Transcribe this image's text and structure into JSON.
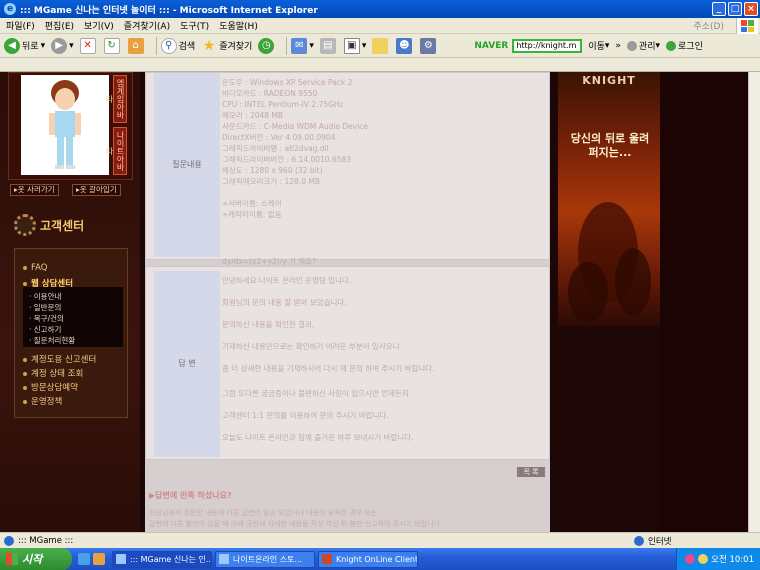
{
  "window": {
    "title": "::: MGame 신나는 인터넷 놀이터 ::: - Microsoft Internet Explorer",
    "buttons": [
      "_",
      "□",
      "×"
    ]
  },
  "menubar": {
    "items": [
      "파일(F)",
      "편집(E)",
      "보기(V)",
      "즐겨찾기(A)",
      "도구(T)",
      "도움말(H)"
    ],
    "right_label": "주소(D)"
  },
  "toolbar": {
    "back": "뒤로",
    "search": "검색",
    "favorites": "즐겨찾기",
    "naver": "NAVER",
    "url": "http://knight.m",
    "go": "이동",
    "manage": "관리",
    "login": "로그인"
  },
  "leftnav": {
    "vtab1": "엠게임아바타",
    "vtab2": "나이트아바타",
    "btn_buy": "옷 사러가기",
    "btn_change": "옷 갈아입기",
    "section_title": "고객센터",
    "menu": [
      "FAQ",
      "웹 상담센터",
      "계정도용 신고센터",
      "계정 상태 조회",
      "방문상담예약",
      "운영정책"
    ],
    "submenu": [
      "이용안내",
      "일반문의",
      "복구/건의",
      "신고하기",
      "질문처리현황"
    ]
  },
  "question": {
    "label": "질문내용",
    "lines": [
      "운도우 : Windows XP Service Pack 2",
      "비디오카드 : RADEON 9550",
      "CPU : INTEL Pentium-IV 2.75GHz",
      "메모리 : 2048 MB",
      "사운드카드 : C-Media WDM Audio Device",
      "DirectX버전 : Ver 4.09.00.0904",
      "그래픽드라이버명 : ati2dvag.dll",
      "그래픽드라이버버전 : 6.14.0010.6583",
      "해상도 : 1280 x 960 (32 bit)",
      "그래픽메모리크기 : 128.0 MB",
      "",
      "+서버이름: 스케이",
      "+캐릭터이름: 없음",
      "",
      "",
      "dy/dx=(x2+y2)/y 가 뭐죠?"
    ]
  },
  "answer": {
    "label": "답 변",
    "lines": [
      "안녕하세요 나이트 온라인 운영팀 입니다.",
      "회원님의 문의 내용 잘 받아 보았습니다.",
      "문의하신 내용을 확인한 결과,",
      "기재하신 내용만으로는 확인하기 어려운 부분이 있사오니",
      "좀 더 상세한 내용을 기재하시어 다시 재 문의 하여 주시기 바랍니다.",
      "그럼 또다른 궁금증이나 불편하신 사항이 있으시면 언제든지",
      "고객센터 1:1 문의를 이용하여 문의 주시기 바랍니다.",
      "오늘도 나이트 온라인과 함께 즐거운 하루 보내시기 바랍니다."
    ]
  },
  "list_button": "목 록",
  "response": {
    "heading": "▶답변에 만족 하셨나요?",
    "body_1": "회원님께서 질문한 내용에 다른 답변이 발송 되었거나 내용이 부족한 경우 또는",
    "body_2": "답변에 다른 불만이 있을 때 아래 공란에 자세한 내용을 작성 하신 뒤 불만 신고하여 주시기 바랍니다."
  },
  "banner": {
    "logo": "KNIGHT",
    "slogan": "당신의 뒤로 울려 퍼지는..."
  },
  "statusbar": {
    "text": "::: MGame :::",
    "zone": "인터넷"
  },
  "taskbar": {
    "start": "시작",
    "tasks": [
      "::: MGame 신나는 인...",
      "나이트온라인 스토...",
      "Knight OnLine Client"
    ],
    "clock": "오전 10:01"
  },
  "colors": {
    "titlebar": "#0a5fd8",
    "page_bg": "#1c0606",
    "content_bg": "#d7cfcf",
    "menu_text": "#f2c880"
  }
}
